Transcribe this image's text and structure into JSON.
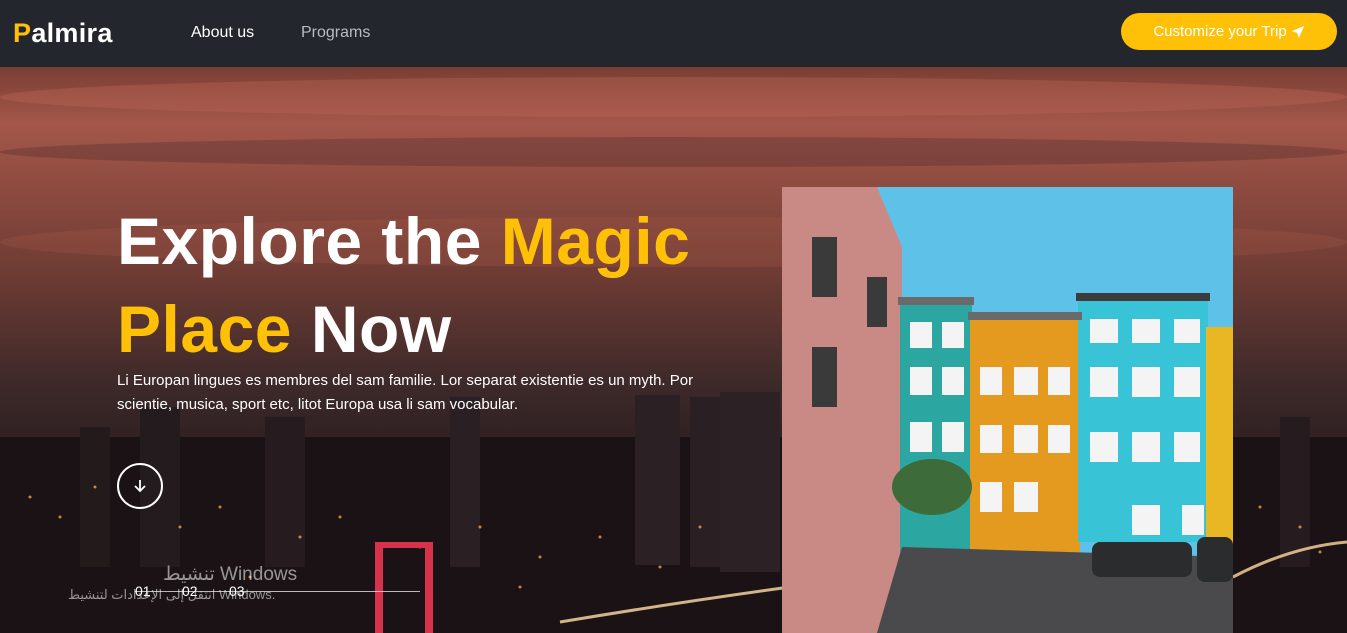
{
  "brand": {
    "first_letter": "P",
    "rest": "almira"
  },
  "nav": {
    "about": "About us",
    "programs": "Programs"
  },
  "cta": {
    "label": "Customize your Trip",
    "icon": "paper-plane-icon"
  },
  "hero": {
    "title_line1_white": "Explore the ",
    "title_line1_yellow": "Magic",
    "title_line2_yellow": "Place ",
    "title_line2_white": "Now",
    "description": "Li Europan lingues es membres del sam familie. Lor separat existentie es un myth. Por scientie, musica, sport etc, litot Europa usa li sam vocabular.",
    "scroll_icon": "arrow-down-icon"
  },
  "slides": [
    "01",
    "02",
    "03"
  ],
  "watermark": {
    "line1": "تنشيط Windows",
    "line2": "انتقل إلى الإعدادات لتنشيط Windows."
  },
  "colors": {
    "accent": "#ffc107",
    "navbar": "#23262c"
  }
}
